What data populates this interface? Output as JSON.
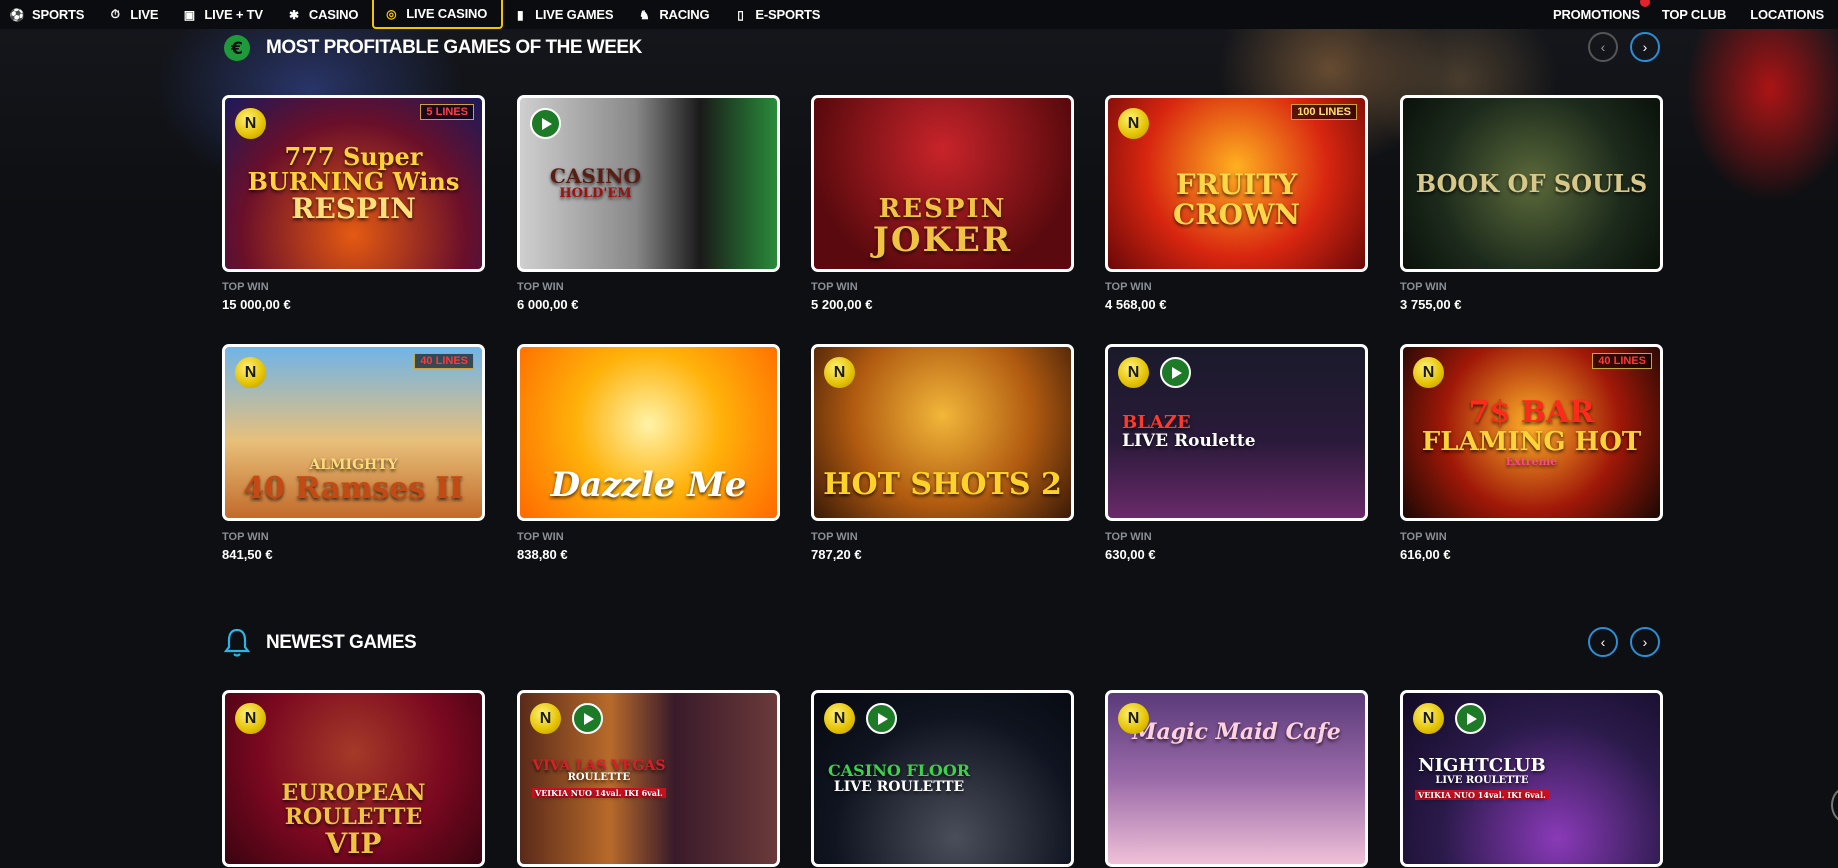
{
  "nav": {
    "left": [
      {
        "label": "SPORTS",
        "icon": "soccer-ball-icon"
      },
      {
        "label": "LIVE",
        "icon": "stopwatch-icon"
      },
      {
        "label": "LIVE + TV",
        "icon": "tv-icon"
      },
      {
        "label": "CASINO",
        "icon": "chip-icon"
      },
      {
        "label": "LIVE CASINO",
        "icon": "live-chip-icon",
        "active": true
      },
      {
        "label": "LIVE GAMES",
        "icon": "cards-icon"
      },
      {
        "label": "RACING",
        "icon": "horse-icon"
      },
      {
        "label": "E-SPORTS",
        "icon": "gamepad-icon"
      }
    ],
    "right": [
      {
        "label": "PROMOTIONS"
      },
      {
        "label": "TOP CLUB"
      },
      {
        "label": "LOCATIONS"
      }
    ]
  },
  "sections": {
    "profitable": {
      "title": "MOST PROFITABLE GAMES OF THE WEEK",
      "icon": "euro-icon",
      "win_label": "TOP WIN",
      "games": [
        {
          "name": "Super Burning Wins Respin",
          "line1": "777 Super",
          "line2": "BURNING Wins",
          "line3": "RESPIN",
          "badge": "5 LINES",
          "win": "15 000,00 €"
        },
        {
          "name": "Casino Hold'em",
          "line1": "CASINO",
          "line2": "HOLD'EM",
          "win": "6 000,00 €"
        },
        {
          "name": "Respin Joker",
          "line1": "RESPIN",
          "line2": "JOKER",
          "win": "5 200,00 €"
        },
        {
          "name": "Fruity Crown",
          "line1": "FRUITY CROWN",
          "badge": "100 LINES",
          "win": "4 568,00 €"
        },
        {
          "name": "Book of Souls",
          "line1": "BOOK OF SOULS",
          "win": "3 755,00 €"
        },
        {
          "name": "40 Almighty Ramses II",
          "line1": "ALMIGHTY",
          "line2": "40 Ramses II",
          "badge": "40 LINES",
          "win": "841,50 €"
        },
        {
          "name": "Dazzle Me",
          "line1": "Dazzle Me",
          "win": "838,80 €"
        },
        {
          "name": "Hot Shots 2",
          "line1": "HOT SHOTS 2",
          "win": "787,20 €"
        },
        {
          "name": "Blaze Live Roulette",
          "line1": "BLAZE",
          "line2": "LIVE Roulette",
          "win": "630,00 €"
        },
        {
          "name": "Flaming Hot Extreme",
          "line1": "7$ BAR",
          "line2": "FLAMING HOT",
          "line3": "Extreme",
          "badge": "40 LINES",
          "win": "616,00 €"
        }
      ]
    },
    "newest": {
      "title": "NEWEST GAMES",
      "icon": "bell-icon",
      "games": [
        {
          "name": "European Roulette VIP",
          "line1": "EUROPEAN ROULETTE",
          "line2": "VIP"
        },
        {
          "name": "Viva Las Vegas Roulette",
          "line1": "VIVA LAS VEGAS",
          "line2": "ROULETTE",
          "line3": "VEIKIA NUO 14val. IKI 6val."
        },
        {
          "name": "Casino Floor Live Roulette",
          "line1": "CASINO FLOOR",
          "line2": "LIVE ROULETTE"
        },
        {
          "name": "Magic Maid Cafe",
          "line1": "Magic Maid Cafe"
        },
        {
          "name": "Nightclub Live Roulette",
          "line1": "NIGHTCLUB",
          "line2": "LIVE ROULETTE",
          "line3": "VEIKIA NUO 14val. IKI 6val."
        }
      ]
    }
  },
  "colors": {
    "accent": "#f5c400",
    "arrow": "#2a8fd6",
    "badge": "#e1242c"
  }
}
